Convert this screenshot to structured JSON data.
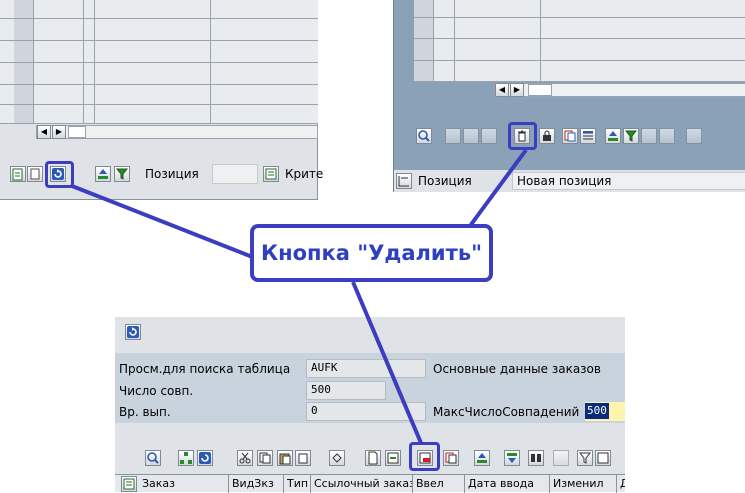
{
  "callout": {
    "text": "Кнопка \"Удалить\"",
    "line_color": "#3d3dbf"
  },
  "panel_left": {
    "position_label": "Позиция",
    "criteria_label": "Крите"
  },
  "panel_right": {
    "position_label": "Позиция",
    "new_position": "Новая позиция"
  },
  "panel_bottom": {
    "fields": [
      {
        "label": "Просм.для поиска таблица",
        "value": "AUFK",
        "description": "Основные данные заказов"
      },
      {
        "label": "Число совп.",
        "value": "500"
      },
      {
        "label": "Вр. вып.",
        "value": "0",
        "extra_label": "МаксЧислоСовпадений",
        "extra_value": "500"
      }
    ],
    "columns": [
      "Заказ",
      "ВидЗкз",
      "Тип",
      "Ссылочный заказ",
      "Ввел",
      "Дата ввода",
      "Изменил",
      "Д"
    ]
  },
  "icons": {
    "refresh": "refresh-icon",
    "delete": "trash-icon",
    "delete_row": "delete-row-icon",
    "sort_asc": "sort-ascending-icon",
    "filter": "filter-icon"
  }
}
